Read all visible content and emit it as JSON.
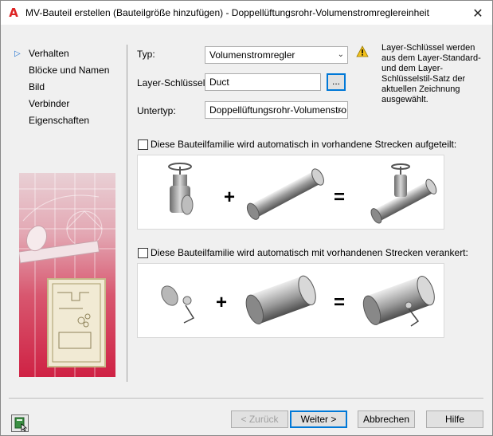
{
  "window": {
    "title": "MV-Bauteil erstellen (Bauteilgröße hinzufügen) - Doppellüftungsrohr-Volumenstromreglereinheit",
    "logo_letter": "A",
    "close_glyph": "✕"
  },
  "nav": {
    "active_marker": "▷",
    "items": [
      {
        "label": "Verhalten",
        "active": true
      },
      {
        "label": "Blöcke und Namen",
        "active": false
      },
      {
        "label": "Bild",
        "active": false
      },
      {
        "label": "Verbinder",
        "active": false
      },
      {
        "label": "Eigenschaften",
        "active": false
      }
    ]
  },
  "form": {
    "typ_label": "Typ:",
    "typ_value": "Volumenstromregler",
    "layer_label": "Layer-Schlüssel:",
    "layer_value": "Duct",
    "browse_label": "...",
    "untertyp_label": "Untertyp:",
    "untertyp_value": "Doppellüftungsrohr-Volumenstro"
  },
  "info": {
    "icon": "warning-icon",
    "text": "Layer-Schlüssel werden aus dem Layer-Standard- und dem Layer-Schlüsselstil-Satz der aktuellen Zeichnung ausgewählt."
  },
  "options": {
    "split_label": "Diese Bauteilfamilie wird automatisch in vorhandene Strecken aufgeteilt:",
    "split_checked": false,
    "anchor_label": "Diese Bauteilfamilie wird automatisch mit vorhandenen Strecken verankert:",
    "anchor_checked": false
  },
  "equation": {
    "plus": "+",
    "equals": "="
  },
  "buttons": {
    "back": "< Zurück",
    "next": "Weiter >",
    "cancel": "Abbrechen",
    "help": "Hilfe"
  },
  "colors": {
    "accent": "#0078d7",
    "nav_marker": "#1c6fd0",
    "logo": "#dd2222"
  }
}
